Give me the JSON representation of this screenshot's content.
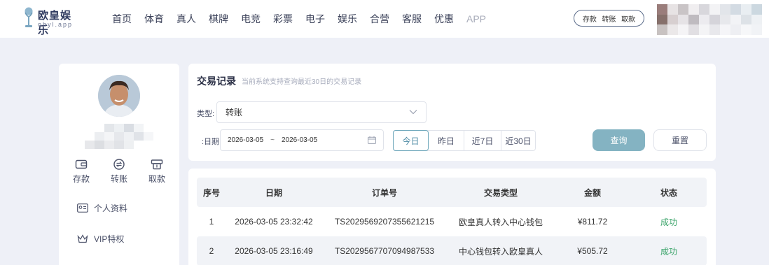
{
  "brand": {
    "name": "欧皇娱乐",
    "domain": "ohyl.app"
  },
  "nav": [
    "首页",
    "体育",
    "真人",
    "棋牌",
    "电竞",
    "彩票",
    "电子",
    "娱乐",
    "合营",
    "客服",
    "优惠",
    "APP"
  ],
  "quick_actions": [
    "存款",
    "转账",
    "取款"
  ],
  "sidebar": {
    "actions": [
      {
        "label": "存款",
        "icon": "wallet-icon"
      },
      {
        "label": "转账",
        "icon": "transfer-icon"
      },
      {
        "label": "取款",
        "icon": "withdraw-icon"
      }
    ],
    "links": [
      {
        "label": "个人资料",
        "icon": "id-card-icon"
      },
      {
        "label": "VIP特权",
        "icon": "crown-icon"
      }
    ]
  },
  "filter": {
    "title": "交易记录",
    "subtitle": "当前系统支持查询最近30日的交易记录",
    "type_label": "类型:",
    "type_value": "转账",
    "date_label": "日期:",
    "date_start": "2026-03-05",
    "date_sep": "~",
    "date_end": "2026-03-05",
    "ranges": [
      "今日",
      "昨日",
      "近7日",
      "近30日"
    ],
    "active_range": "今日",
    "query_label": "查询",
    "reset_label": "重置"
  },
  "table": {
    "headers": [
      "序号",
      "日期",
      "订单号",
      "交易类型",
      "金额",
      "状态"
    ],
    "rows": [
      [
        "1",
        "2026-03-05 23:32:42",
        "TS2029569207355621215",
        "欧皇真人转入中心钱包",
        "¥811.72",
        "成功"
      ],
      [
        "2",
        "2026-03-05 23:16:49",
        "TS2029567707094987533",
        "中心钱包转入欧皇真人",
        "¥505.72",
        "成功"
      ]
    ]
  },
  "colors": {
    "accent": "#84b3c2",
    "success": "#3ba46a",
    "background": "#eef0f7"
  }
}
